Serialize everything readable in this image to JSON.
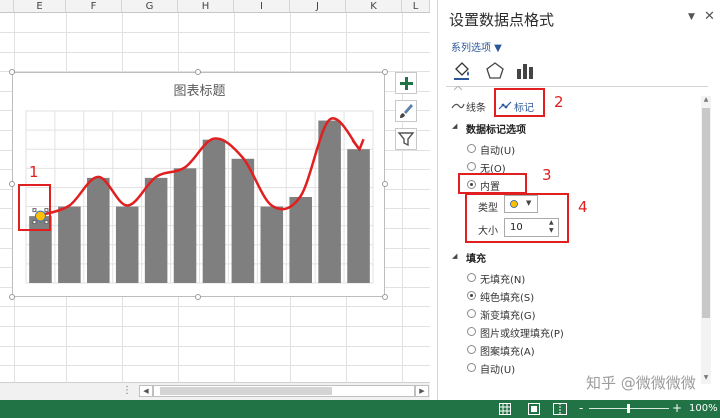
{
  "spreadsheet": {
    "columns": [
      "E",
      "F",
      "G",
      "H",
      "I",
      "J",
      "K",
      "L"
    ]
  },
  "chart": {
    "title": "图表标题"
  },
  "chart_data": {
    "type": "bar",
    "categories": [],
    "values": [
      7,
      8,
      11,
      8,
      11,
      12,
      15,
      13,
      8,
      9,
      17,
      14
    ],
    "ylim": [
      0,
      18
    ],
    "grid": true,
    "legend": "none",
    "bar_color": "#7f7f7f",
    "highlighted_point_index": 0,
    "marker_color": "#ffc000"
  },
  "chart_side_buttons": [
    {
      "name": "chart-elements-button",
      "icon": "plus-icon"
    },
    {
      "name": "chart-styles-button",
      "icon": "brush-icon"
    },
    {
      "name": "chart-filters-button",
      "icon": "filter-icon"
    }
  ],
  "pane": {
    "title": "设置数据点格式",
    "series_options_label": "系列选项 ▼",
    "tab_line_label": "线条",
    "tab_marker_label": "标记",
    "marker_options_header": "数据标记选项",
    "marker_options": [
      {
        "label": "自动(U)",
        "selected": false
      },
      {
        "label": "无(O)",
        "selected": false
      },
      {
        "label": "内置",
        "selected": true
      }
    ],
    "type_label": "类型",
    "size_label": "大小",
    "size_value": "10",
    "fill_header": "填充",
    "fill_options": [
      {
        "label": "无填充(N)",
        "selected": false
      },
      {
        "label": "纯色填充(S)",
        "selected": true
      },
      {
        "label": "渐变填充(G)",
        "selected": false
      },
      {
        "label": "图片或纹理填充(P)",
        "selected": false
      },
      {
        "label": "图案填充(A)",
        "selected": false
      },
      {
        "label": "自动(U)",
        "selected": false
      }
    ]
  },
  "annotations": {
    "num1": "1",
    "num2": "2",
    "num3": "3",
    "num4": "4",
    "color": "#e02020"
  },
  "watermark": "知乎 @微微微微",
  "status": {
    "zoom": "100%",
    "zoom_minus": "-",
    "zoom_plus": "+"
  },
  "colors": {
    "excel_green": "#217346",
    "accent_blue": "#2b579a"
  }
}
